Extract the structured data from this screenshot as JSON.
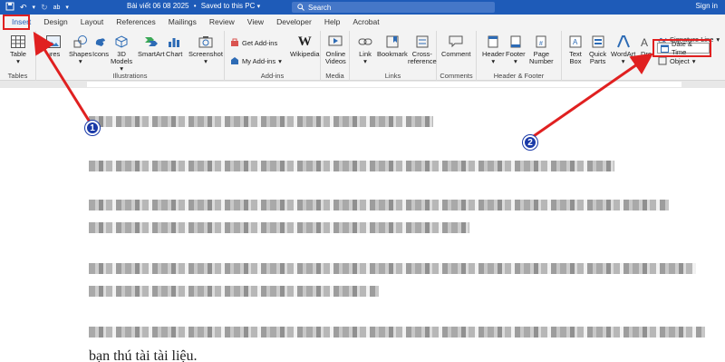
{
  "titlebar": {
    "doc_name": "Bài viết 06 08 2025",
    "separator": "•",
    "save_status": "Saved to this PC",
    "search_placeholder": "Search",
    "sign_in": "Sign in"
  },
  "tabs": [
    "Insert",
    "Design",
    "Layout",
    "References",
    "Mailings",
    "Review",
    "View",
    "Developer",
    "Help",
    "Acrobat"
  ],
  "ribbon": {
    "tables": {
      "label": "Tables",
      "table": "Table"
    },
    "illustrations": {
      "label": "Illustrations",
      "pictures": "ures",
      "shapes": "Shapes",
      "icons": "Icons",
      "models_line1": "3D",
      "models_line2": "Models",
      "smartart": "SmartArt",
      "chart": "Chart",
      "screenshot": "Screenshot"
    },
    "addins": {
      "label": "Add-ins",
      "get": "Get Add-ins",
      "my": "My Add-ins",
      "wikipedia": "Wikipedia"
    },
    "media": {
      "label": "Media",
      "online_line1": "Online",
      "online_line2": "Videos"
    },
    "links": {
      "label": "Links",
      "link": "Link",
      "bookmark": "Bookmark",
      "cross_line1": "Cross-",
      "cross_line2": "reference"
    },
    "comments": {
      "label": "Comments",
      "comment": "Comment"
    },
    "headerfooter": {
      "label": "Header & Footer",
      "header": "Header",
      "footer": "Footer",
      "page_line1": "Page",
      "page_line2": "Number"
    },
    "text": {
      "textbox_line1": "Text",
      "textbox_line2": "Box",
      "quick_line1": "Quick",
      "quick_line2": "Parts",
      "wordart": "WordArt",
      "drop": "Dro",
      "signature": "Signature Line",
      "datetime": "Date & Time",
      "object": "Object"
    }
  },
  "document": {
    "last_line": "bạn thú tài tài liệu."
  },
  "annotations": {
    "badge1": "1",
    "badge2": "2",
    "highlight_color": "#e02020",
    "badge_color": "#1a3aa8"
  },
  "colors": {
    "accent": "#1e5bb8",
    "ribbon_bg": "#f3f3f3"
  }
}
